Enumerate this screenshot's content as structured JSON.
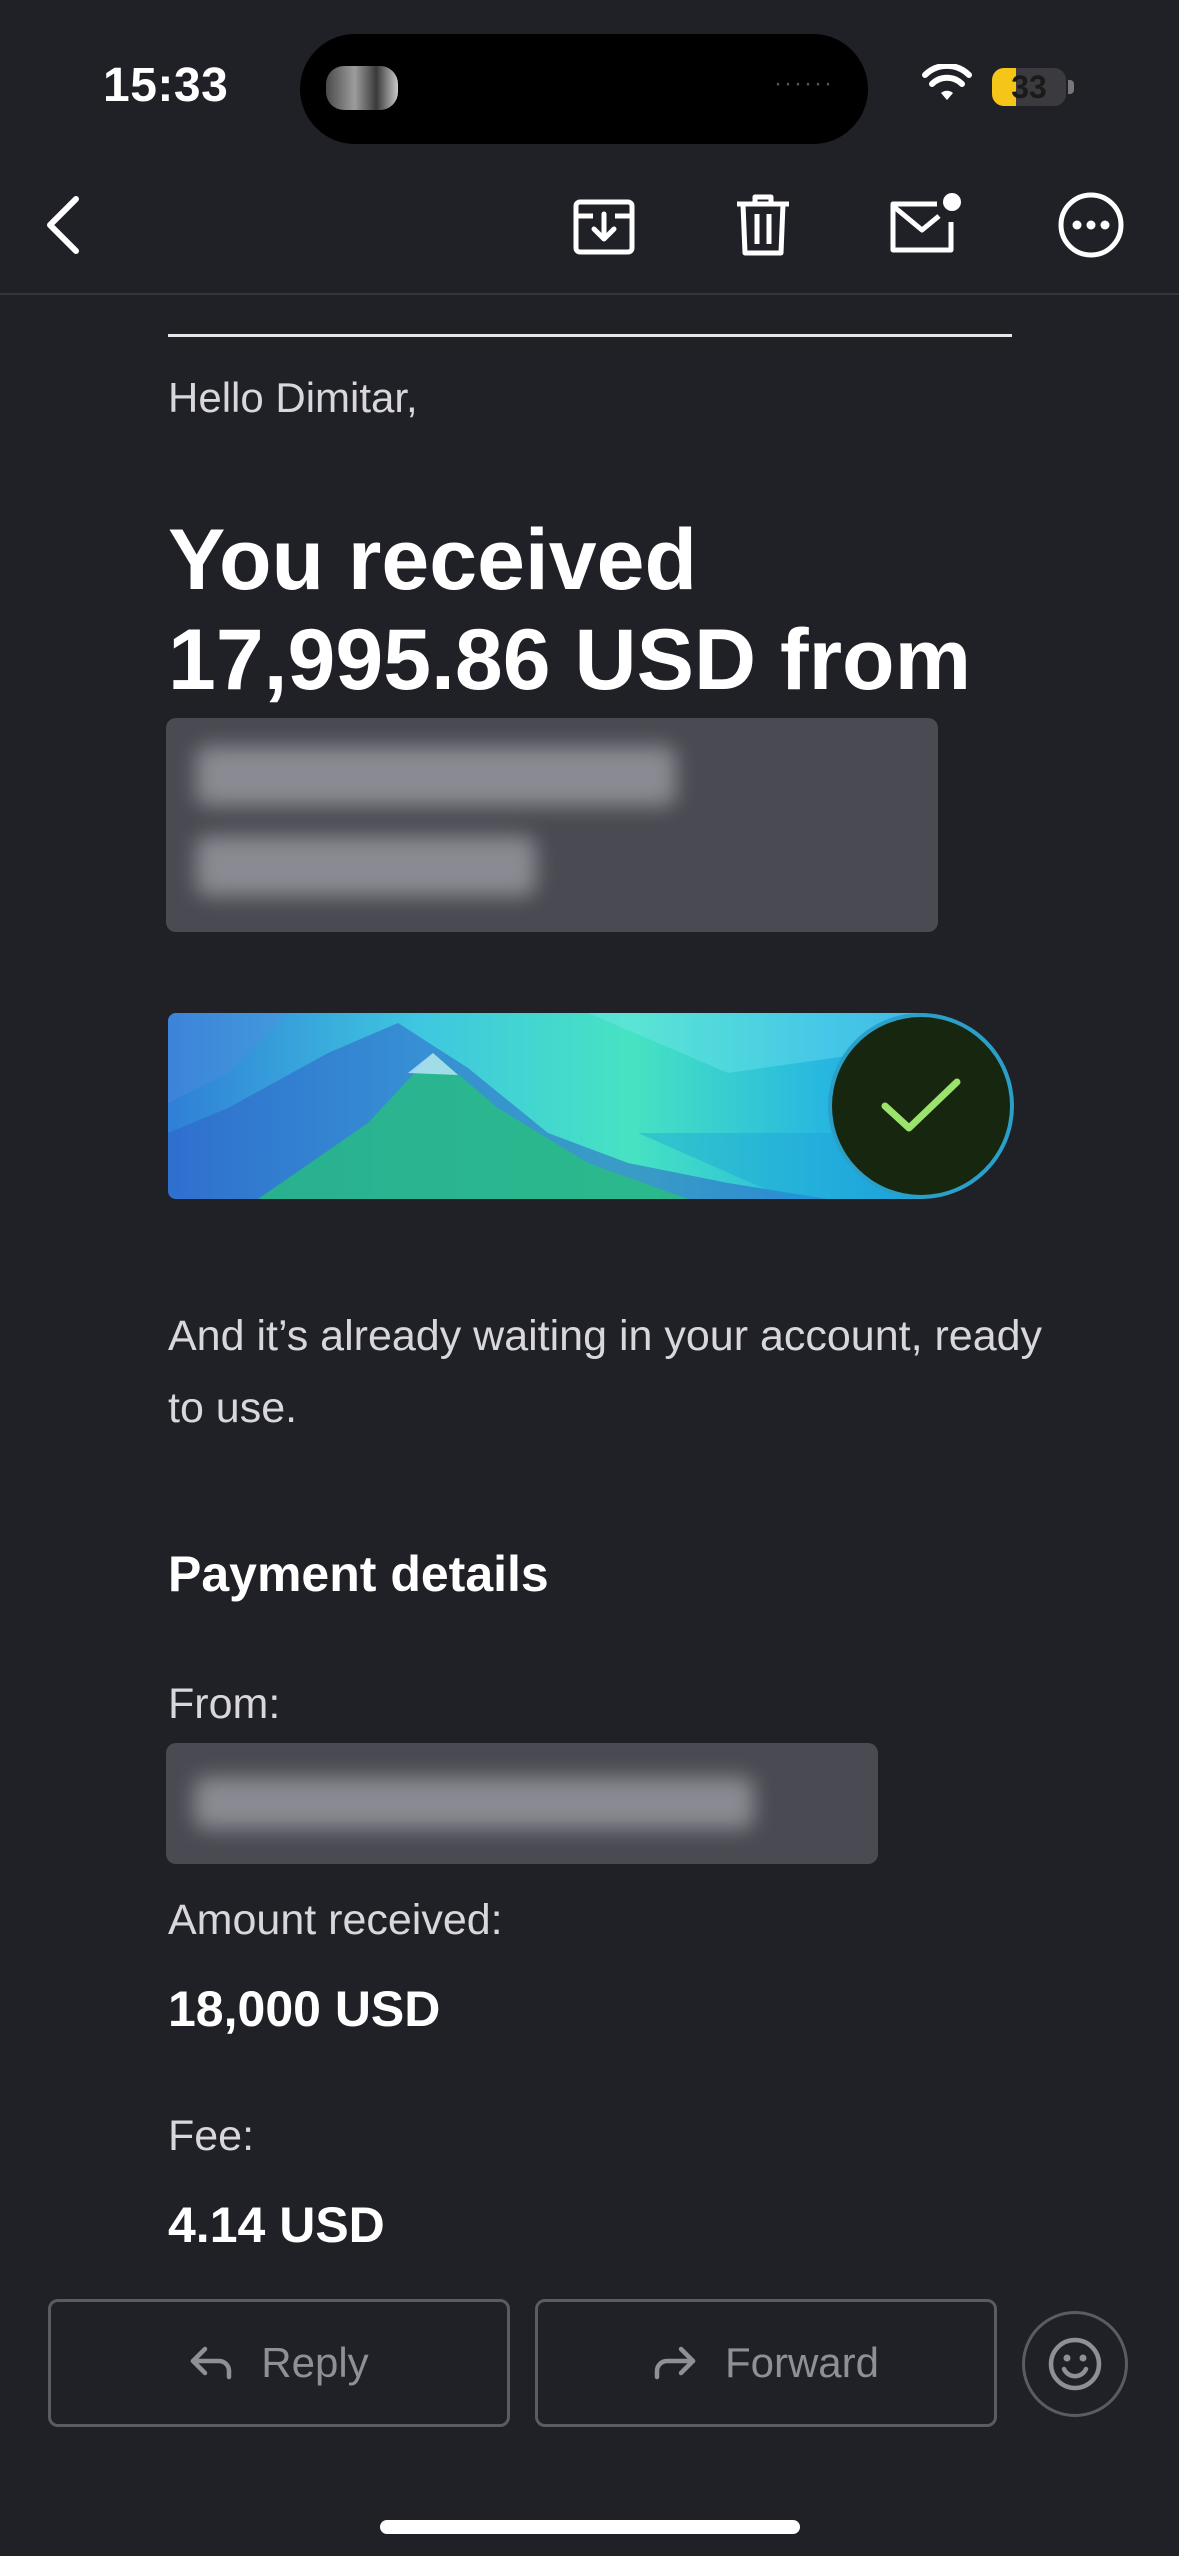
{
  "status_bar": {
    "time": "15:33",
    "battery_level": "33",
    "battery_fraction": 0.33
  },
  "toolbar": {
    "back_icon": "chevron-left-icon",
    "archive_icon": "archive-tray-icon",
    "delete_icon": "trash-icon",
    "mark_unread_icon": "envelope-unread-icon",
    "more_icon": "ellipsis-circle-icon"
  },
  "email": {
    "greeting": "Hello Dimitar,",
    "headline": "You received 17,995.86 USD from",
    "sender_name_redacted": true,
    "banner_icon": "checkmark-icon",
    "message": "And it’s already waiting in your account, ready to use.",
    "payment_details": {
      "title": "Payment details",
      "from_label": "From:",
      "from_value_redacted": true,
      "amount_label": "Amount received:",
      "amount_value": "18,000 USD",
      "fee_label": "Fee:",
      "fee_value": "4.14 USD"
    }
  },
  "actions": {
    "reply_label": "Reply",
    "forward_label": "Forward",
    "reply_icon": "reply-arrow-icon",
    "forward_icon": "forward-arrow-icon",
    "emoji_icon": "smiley-icon"
  },
  "colors": {
    "background": "#202027",
    "text_primary": "#ffffff",
    "text_secondary": "#d7d7dc",
    "button_border": "#5b5b63",
    "check_green": "#9be36a",
    "battery_yellow": "#f5c518"
  }
}
